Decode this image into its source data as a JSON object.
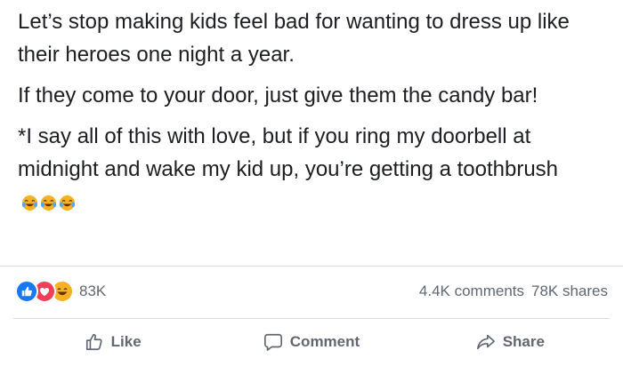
{
  "post": {
    "paragraphs": [
      "Let’s stop making kids feel bad for wanting to dress up like their heroes one night a year.",
      "If they come to your door, just give them the candy bar!",
      "*I say all of this with love, but if you ring my doorbell at midnight and wake my kid up, you’re getting a toothbrush"
    ],
    "trailing_emojis": [
      "laughing-tears-icon",
      "laughing-tears-icon",
      "laughing-tears-icon"
    ]
  },
  "stats": {
    "reactions": [
      "like-icon",
      "love-icon",
      "haha-icon"
    ],
    "reaction_count": "83K",
    "comments": "4.4K comments",
    "shares": "78K shares"
  },
  "actions": {
    "like_label": "Like",
    "comment_label": "Comment",
    "share_label": "Share"
  },
  "colors": {
    "like_blue": "#1877f2",
    "love_red": "#f33e58",
    "haha_yellow": "#f7b125",
    "muted_text": "#606770"
  }
}
